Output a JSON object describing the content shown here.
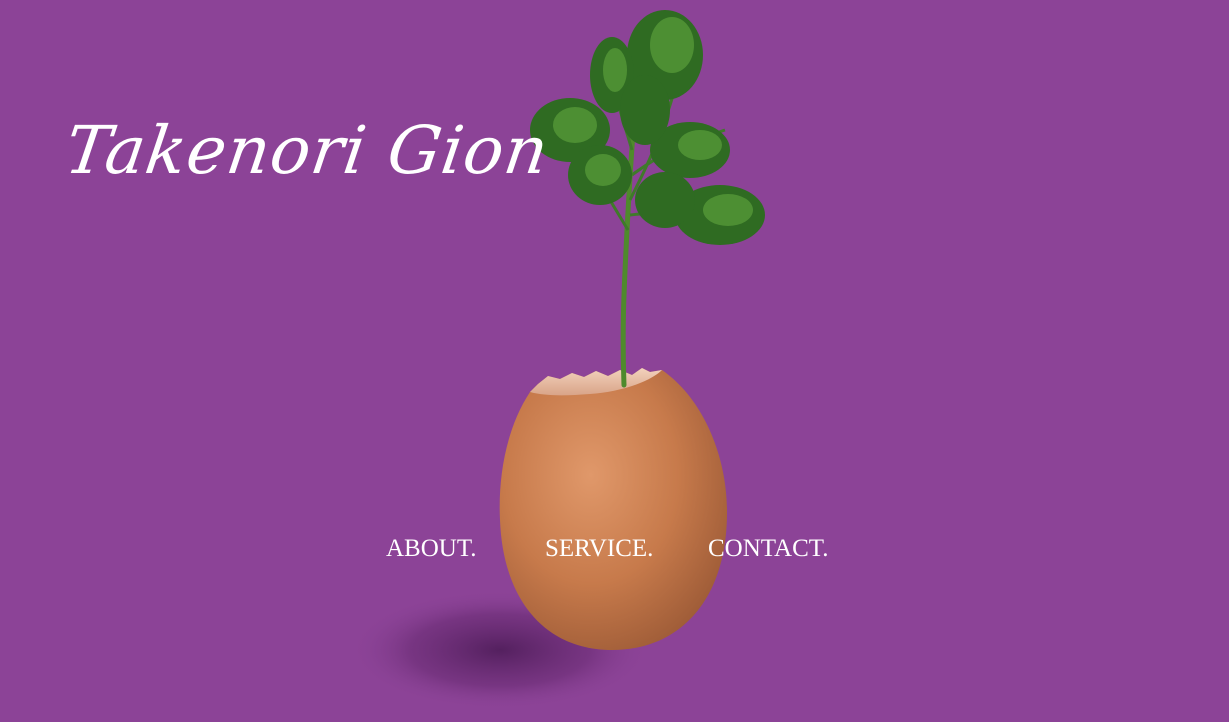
{
  "site": {
    "logo_text": "Takenori Gion",
    "background_color": "#8c4397"
  },
  "hero_image": {
    "icon": "egg-with-sprout-illustration",
    "egg_color": "#c97a4a",
    "sprout_color": "#3f7a2a"
  },
  "nav": {
    "items": [
      {
        "label": "ABOUT."
      },
      {
        "label": "SERVICE."
      },
      {
        "label": "CONTACT."
      }
    ],
    "text_color": "#ffffff"
  }
}
